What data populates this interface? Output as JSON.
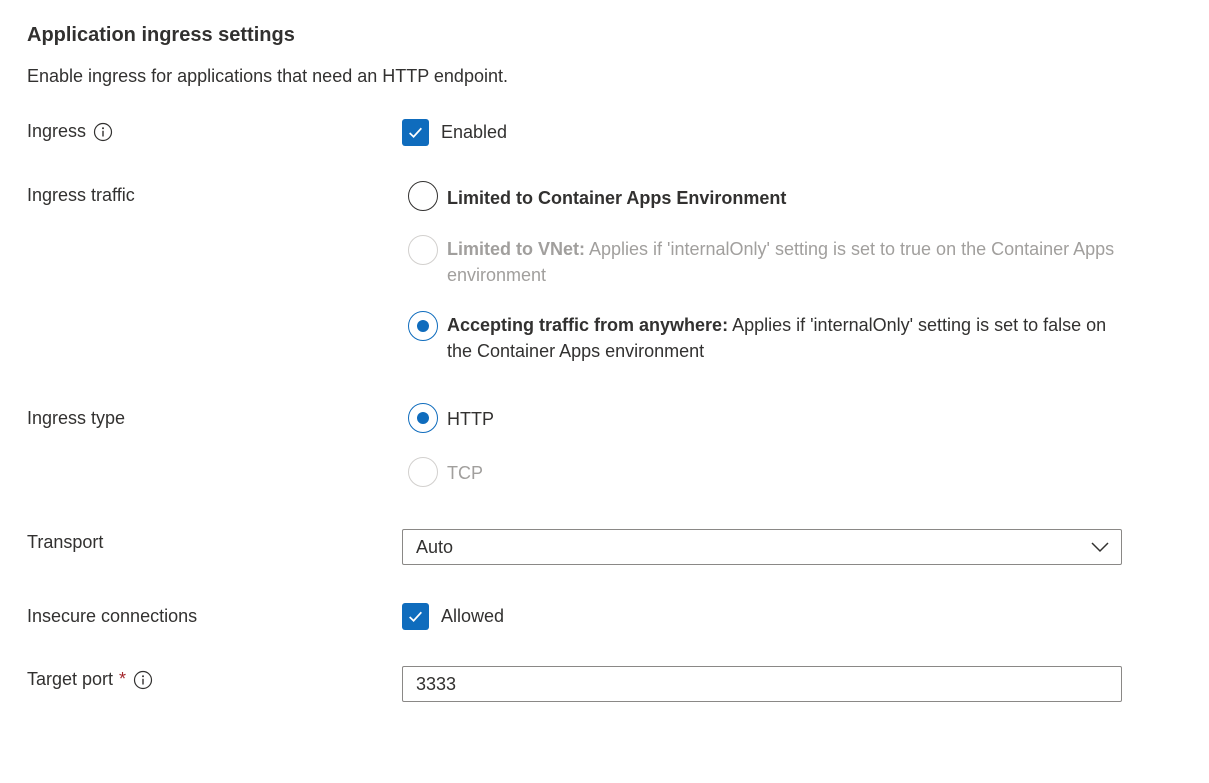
{
  "section": {
    "title": "Application ingress settings",
    "description": "Enable ingress for applications that need an HTTP endpoint."
  },
  "ingress": {
    "label": "Ingress",
    "info_icon": "info-icon",
    "checkbox_label": "Enabled",
    "checked": true
  },
  "ingress_traffic": {
    "label": "Ingress traffic",
    "options": [
      {
        "title": "Limited to Container Apps Environment",
        "description": "",
        "selected": false,
        "disabled": false
      },
      {
        "title": "Limited to VNet:",
        "description": "Applies if 'internalOnly' setting is set to true on the Container Apps environment",
        "selected": false,
        "disabled": true
      },
      {
        "title": "Accepting traffic from anywhere:",
        "description": "Applies if 'internalOnly' setting is set to false on the Container Apps environment",
        "selected": true,
        "disabled": false
      }
    ]
  },
  "ingress_type": {
    "label": "Ingress type",
    "options": [
      {
        "label": "HTTP",
        "selected": true,
        "disabled": false
      },
      {
        "label": "TCP",
        "selected": false,
        "disabled": true
      }
    ]
  },
  "transport": {
    "label": "Transport",
    "value": "Auto",
    "icon": "chevron-down-icon"
  },
  "insecure_connections": {
    "label": "Insecure connections",
    "checkbox_label": "Allowed",
    "checked": true
  },
  "target_port": {
    "label": "Target port",
    "required_marker": "*",
    "info_icon": "info-icon",
    "value": "3333"
  },
  "colors": {
    "accent": "#0f6cbd",
    "text": "#323130",
    "disabled_text": "#a19f9d",
    "required": "#a4262c"
  }
}
